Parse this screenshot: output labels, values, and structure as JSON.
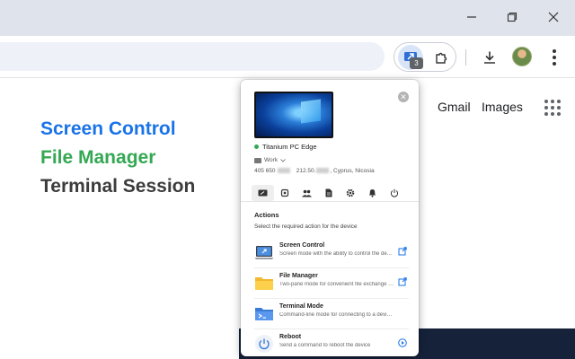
{
  "browser": {
    "extension_badge": "3",
    "window_controls": [
      "minimize-icon",
      "restore-icon",
      "close-icon"
    ]
  },
  "page": {
    "links": {
      "gmail": "Gmail",
      "images": "Images"
    },
    "hero": {
      "line1": "Screen Control",
      "line2": "File Manager",
      "line3": "Terminal Session"
    },
    "colors": {
      "line1": "#1a73e8",
      "line2": "#34a853",
      "line3": "#3c3c3c"
    }
  },
  "popup": {
    "device": {
      "name": "Titanium PC Edge",
      "status_color": "#34a853",
      "group": "Work",
      "id_prefix": "405 650",
      "ip_prefix": "212.50.",
      "location": "Cyprus, Nicosia"
    },
    "tabs": [
      {
        "icon": "remote-screen-icon",
        "active": true
      },
      {
        "icon": "cpu-icon",
        "active": false
      },
      {
        "icon": "users-icon",
        "active": false
      },
      {
        "icon": "document-icon",
        "active": false
      },
      {
        "icon": "gear-icon",
        "active": false
      },
      {
        "icon": "bell-icon",
        "active": false
      },
      {
        "icon": "power-icon",
        "active": false
      }
    ],
    "actions_title": "Actions",
    "actions_subtitle": "Select the required action for the device",
    "items": [
      {
        "title": "Screen Control",
        "desc": "Screen mode with the ability to control the de...",
        "icon": "laptop-icon",
        "action": "open-external-icon"
      },
      {
        "title": "File Manager",
        "desc": "Two-pane mode for convenient file exchange b...",
        "icon": "folder-icon",
        "action": "open-external-icon"
      },
      {
        "title": "Terminal Mode",
        "desc": "Command-line mode for connecting to a device with...",
        "icon": "terminal-icon",
        "action": ""
      },
      {
        "title": "Reboot",
        "desc": "Send a command to reboot the device",
        "icon": "power-icon",
        "action": "play-icon"
      }
    ]
  }
}
